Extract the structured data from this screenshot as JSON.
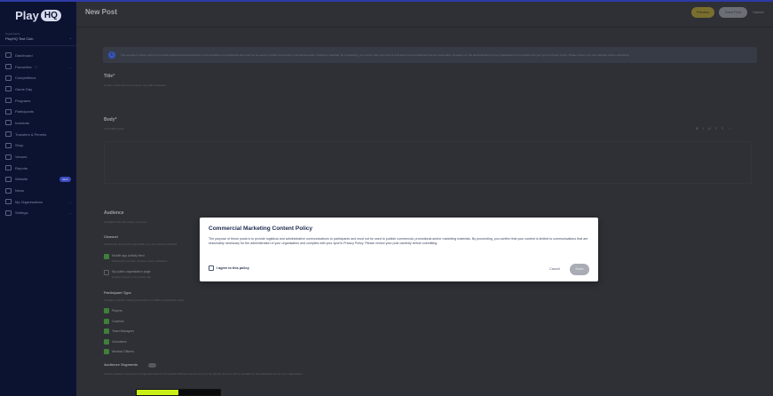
{
  "app": {
    "logo_text": "Play",
    "logo_badge": "HQ",
    "org_caption": "Organisation",
    "org_name": "PlayHQ Test Club"
  },
  "sidebar": {
    "items": [
      {
        "label": "Dashboard",
        "icon": "home-icon"
      },
      {
        "label": "Favourites",
        "icon": "star-icon",
        "external": true,
        "chevron": true
      },
      {
        "label": "Competitions",
        "icon": "trophy-icon"
      },
      {
        "label": "Game Day",
        "icon": "whistle-icon"
      },
      {
        "label": "Programs",
        "icon": "calendar-icon"
      },
      {
        "label": "Participants",
        "icon": "people-icon"
      },
      {
        "label": "Incidents",
        "icon": "warning-icon"
      },
      {
        "label": "Transfers & Permits",
        "icon": "transfer-icon"
      },
      {
        "label": "Shop",
        "icon": "shop-icon"
      },
      {
        "label": "Venues",
        "icon": "venue-icon"
      },
      {
        "label": "Reports",
        "icon": "report-icon"
      },
      {
        "label": "Website",
        "icon": "website-icon",
        "badge": "NEW"
      },
      {
        "label": "News",
        "icon": "news-icon"
      },
      {
        "label": "My Organisations",
        "icon": "globe-icon",
        "chevron": true
      },
      {
        "label": "Settings",
        "icon": "gear-icon",
        "chevron": true
      }
    ]
  },
  "header": {
    "title": "New Post",
    "preview_label": "Preview",
    "save_label": "Save Post",
    "cancel_label": "Cancel"
  },
  "form": {
    "notice": "The purpose of these posts is to provide logistical and administrative communications to participants and must not be used to publish commercial, promotional and/or marketing materials. By proceeding, you confirm that your content is limited to communications that are reasonably necessary for the administration of your organisation and complies with your sport's Privacy Policy. Please review your post carefully before submitting.",
    "title_label": "Title*",
    "title_hint": "Create a short title for your post, max 200 characters",
    "body_label": "Body*",
    "body_hint": "Limit 5000 words",
    "audience_label": "Audience",
    "audience_hint": "Configure who will receive your post",
    "channel_label": "Channel",
    "channel_hint": "Choose the channel through which your post will be published",
    "channel_options": [
      {
        "label": "Mobile app activity feed",
        "sub": "Participants will also receive a push notification",
        "checked": true
      },
      {
        "label": "My public organisation page",
        "sub": "Display content in the mobile app",
        "checked": false
      }
    ],
    "participant_type_label": "Participant Type",
    "participant_type_hint": "Configure specific viewing permissions for different participant types",
    "participant_types": [
      {
        "label": "Players",
        "checked": true
      },
      {
        "label": "Coaches",
        "checked": true
      },
      {
        "label": "Team Managers",
        "checked": true
      },
      {
        "label": "Volunteers",
        "checked": true
      },
      {
        "label": "Medical Officers",
        "checked": true
      }
    ],
    "segments_label": "Audience Segments",
    "segments_hint": "Choose audience segments to target participants with specific attributes across your org. By default, the post will be viewable by all participants across your organisation."
  },
  "editor_tools": [
    "B",
    "I",
    "U",
    "≡",
    "≡",
    "⇔"
  ],
  "modal": {
    "title": "Commercial Marketing Content Policy",
    "body": "The purpose of these posts is to provide logistical and administrative communications to participants and must not be used to publish commercial, promotional and/or marketing materials. By proceeding, you confirm that your content is limited to communications that are reasonably necessary for the administration of your organisation and complies with your sport's Privacy Policy. Please review your post carefully before submitting.",
    "agree_label": "I agree to this policy",
    "cancel_label": "Cancel",
    "done_label": "Done"
  },
  "colors": {
    "sidebar_bg": "#0c1330",
    "header_accent": "#2f3aa6",
    "overlay_bg": "#2e3036",
    "preview_button": "#7a6e2e",
    "checkbox_checked": "#3f7f3a",
    "info_icon": "#3553b8",
    "highlight_lime": "#c8f018"
  }
}
